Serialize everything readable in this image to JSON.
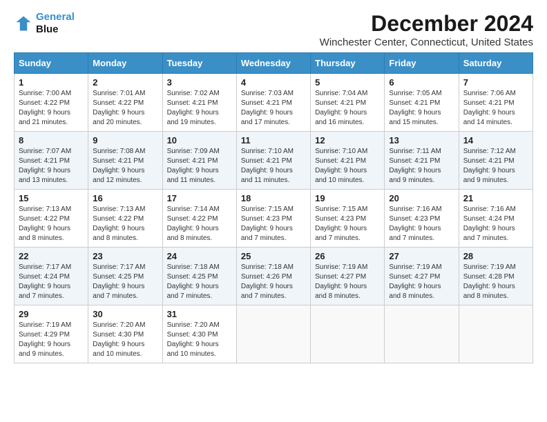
{
  "logo": {
    "line1": "General",
    "line2": "Blue"
  },
  "title": "December 2024",
  "subtitle": "Winchester Center, Connecticut, United States",
  "days_header": [
    "Sunday",
    "Monday",
    "Tuesday",
    "Wednesday",
    "Thursday",
    "Friday",
    "Saturday"
  ],
  "weeks": [
    [
      {
        "day": "1",
        "sunrise": "7:00 AM",
        "sunset": "4:22 PM",
        "daylight": "9 hours and 21 minutes."
      },
      {
        "day": "2",
        "sunrise": "7:01 AM",
        "sunset": "4:22 PM",
        "daylight": "9 hours and 20 minutes."
      },
      {
        "day": "3",
        "sunrise": "7:02 AM",
        "sunset": "4:21 PM",
        "daylight": "9 hours and 19 minutes."
      },
      {
        "day": "4",
        "sunrise": "7:03 AM",
        "sunset": "4:21 PM",
        "daylight": "9 hours and 17 minutes."
      },
      {
        "day": "5",
        "sunrise": "7:04 AM",
        "sunset": "4:21 PM",
        "daylight": "9 hours and 16 minutes."
      },
      {
        "day": "6",
        "sunrise": "7:05 AM",
        "sunset": "4:21 PM",
        "daylight": "9 hours and 15 minutes."
      },
      {
        "day": "7",
        "sunrise": "7:06 AM",
        "sunset": "4:21 PM",
        "daylight": "9 hours and 14 minutes."
      }
    ],
    [
      {
        "day": "8",
        "sunrise": "7:07 AM",
        "sunset": "4:21 PM",
        "daylight": "9 hours and 13 minutes."
      },
      {
        "day": "9",
        "sunrise": "7:08 AM",
        "sunset": "4:21 PM",
        "daylight": "9 hours and 12 minutes."
      },
      {
        "day": "10",
        "sunrise": "7:09 AM",
        "sunset": "4:21 PM",
        "daylight": "9 hours and 11 minutes."
      },
      {
        "day": "11",
        "sunrise": "7:10 AM",
        "sunset": "4:21 PM",
        "daylight": "9 hours and 11 minutes."
      },
      {
        "day": "12",
        "sunrise": "7:10 AM",
        "sunset": "4:21 PM",
        "daylight": "9 hours and 10 minutes."
      },
      {
        "day": "13",
        "sunrise": "7:11 AM",
        "sunset": "4:21 PM",
        "daylight": "9 hours and 9 minutes."
      },
      {
        "day": "14",
        "sunrise": "7:12 AM",
        "sunset": "4:21 PM",
        "daylight": "9 hours and 9 minutes."
      }
    ],
    [
      {
        "day": "15",
        "sunrise": "7:13 AM",
        "sunset": "4:22 PM",
        "daylight": "9 hours and 8 minutes."
      },
      {
        "day": "16",
        "sunrise": "7:13 AM",
        "sunset": "4:22 PM",
        "daylight": "9 hours and 8 minutes."
      },
      {
        "day": "17",
        "sunrise": "7:14 AM",
        "sunset": "4:22 PM",
        "daylight": "9 hours and 8 minutes."
      },
      {
        "day": "18",
        "sunrise": "7:15 AM",
        "sunset": "4:23 PM",
        "daylight": "9 hours and 7 minutes."
      },
      {
        "day": "19",
        "sunrise": "7:15 AM",
        "sunset": "4:23 PM",
        "daylight": "9 hours and 7 minutes."
      },
      {
        "day": "20",
        "sunrise": "7:16 AM",
        "sunset": "4:23 PM",
        "daylight": "9 hours and 7 minutes."
      },
      {
        "day": "21",
        "sunrise": "7:16 AM",
        "sunset": "4:24 PM",
        "daylight": "9 hours and 7 minutes."
      }
    ],
    [
      {
        "day": "22",
        "sunrise": "7:17 AM",
        "sunset": "4:24 PM",
        "daylight": "9 hours and 7 minutes."
      },
      {
        "day": "23",
        "sunrise": "7:17 AM",
        "sunset": "4:25 PM",
        "daylight": "9 hours and 7 minutes."
      },
      {
        "day": "24",
        "sunrise": "7:18 AM",
        "sunset": "4:25 PM",
        "daylight": "9 hours and 7 minutes."
      },
      {
        "day": "25",
        "sunrise": "7:18 AM",
        "sunset": "4:26 PM",
        "daylight": "9 hours and 7 minutes."
      },
      {
        "day": "26",
        "sunrise": "7:19 AM",
        "sunset": "4:27 PM",
        "daylight": "9 hours and 8 minutes."
      },
      {
        "day": "27",
        "sunrise": "7:19 AM",
        "sunset": "4:27 PM",
        "daylight": "9 hours and 8 minutes."
      },
      {
        "day": "28",
        "sunrise": "7:19 AM",
        "sunset": "4:28 PM",
        "daylight": "9 hours and 8 minutes."
      }
    ],
    [
      {
        "day": "29",
        "sunrise": "7:19 AM",
        "sunset": "4:29 PM",
        "daylight": "9 hours and 9 minutes."
      },
      {
        "day": "30",
        "sunrise": "7:20 AM",
        "sunset": "4:30 PM",
        "daylight": "9 hours and 10 minutes."
      },
      {
        "day": "31",
        "sunrise": "7:20 AM",
        "sunset": "4:30 PM",
        "daylight": "9 hours and 10 minutes."
      },
      null,
      null,
      null,
      null
    ]
  ]
}
